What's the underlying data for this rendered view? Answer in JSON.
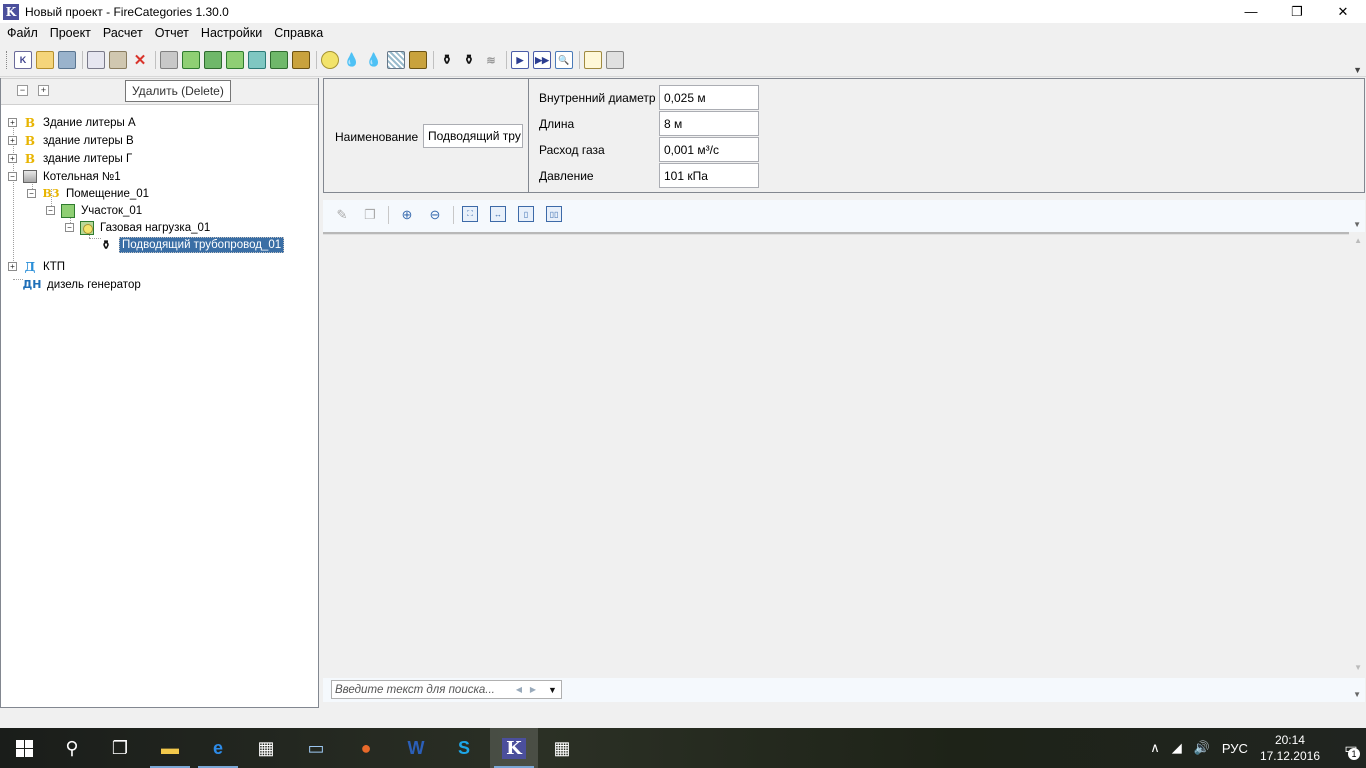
{
  "window": {
    "title": "Новый проект - FireCategories 1.30.0",
    "logo_letter": "K",
    "minimize": "—",
    "maximize": "❐",
    "close": "✕"
  },
  "menu": [
    "Файл",
    "Проект",
    "Расчет",
    "Отчет",
    "Настройки",
    "Справка"
  ],
  "toolbar": {
    "tooltip": "Удалить (Delete)",
    "icons": [
      "new-project-icon",
      "open-icon",
      "save-icon",
      "copy-icon",
      "paste-icon",
      "delete-icon",
      "building-icon",
      "add-building-icon",
      "room-icon",
      "gas-load-icon",
      "area-icon",
      "outdoor-icon",
      "flammable-icon",
      "liquid-icon",
      "water-drops-icon",
      "dust-icon",
      "cart-icon",
      "pipe-icon",
      "pipe2-icon",
      "fan-icon",
      "run-icon",
      "run-all-icon",
      "zoom-icon",
      "report-icon",
      "report-table-icon"
    ]
  },
  "tree": {
    "collapse_all": "⊟",
    "expand_all": "⊞",
    "items": [
      {
        "label": "Здание литеры А",
        "icon": "В",
        "icon_name": "building-class-b-icon"
      },
      {
        "label": "здание литеры В",
        "icon": "В",
        "icon_name": "building-class-b-icon"
      },
      {
        "label": "здание литеры Г",
        "icon": "В",
        "icon_name": "building-class-b-icon"
      },
      {
        "label": "Котельная №1",
        "icon": "",
        "icon_name": "boiler-house-icon"
      },
      {
        "label": "Помещение_01",
        "icon": "В3",
        "icon_name": "room-class-b3-icon"
      },
      {
        "label": "Участок_01",
        "icon": "",
        "icon_name": "area-icon"
      },
      {
        "label": "Газовая нагрузка_01",
        "icon": "",
        "icon_name": "gas-load-icon"
      },
      {
        "label": "Подводящий трубопровод_01",
        "icon": "",
        "icon_name": "pipeline-icon"
      },
      {
        "label": "КТП",
        "icon": "Д",
        "icon_name": "building-class-d-icon"
      },
      {
        "label": "дизель генератор",
        "icon": "ДН",
        "icon_name": "building-class-dn-icon"
      }
    ]
  },
  "properties": {
    "name_label": "Наименование",
    "name_value": "Подводящий тру",
    "rows": [
      {
        "label": "Внутренний диаметр",
        "value": "0,025 м"
      },
      {
        "label": "Длина",
        "value": "8 м"
      },
      {
        "label": "Расход газа",
        "value": "0,001 м³/с"
      },
      {
        "label": "Давление",
        "value": "101 кПа"
      }
    ]
  },
  "search": {
    "placeholder": "Введите текст для поиска..."
  },
  "taskbar": {
    "language": "РУС",
    "time": "20:14",
    "date": "17.12.2016",
    "notifications": "1"
  }
}
